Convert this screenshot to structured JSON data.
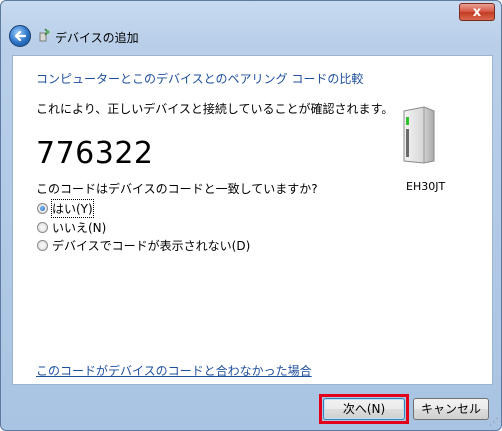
{
  "window": {
    "title": "デバイスの追加",
    "close_label": "x"
  },
  "content": {
    "heading": "コンピューターとこのデバイスとのペアリング コードの比較",
    "description": "これにより、正しいデバイスと接続していることが確認されます。",
    "pairing_code": "776322",
    "device_name": "EH30JT",
    "question": "このコードはデバイスのコードと一致していますか?",
    "options": [
      {
        "label": "はい(Y)",
        "selected": true
      },
      {
        "label": "いいえ(N)",
        "selected": false
      },
      {
        "label": "デバイスでコードが表示されない(D)",
        "selected": false
      }
    ],
    "mismatch_link": "このコードがデバイスのコードと合わなかった場合"
  },
  "buttons": {
    "next": "次へ(N)",
    "cancel": "キャンセル"
  },
  "colors": {
    "heading": "#1e4f9e",
    "highlight": "#e2001a"
  }
}
